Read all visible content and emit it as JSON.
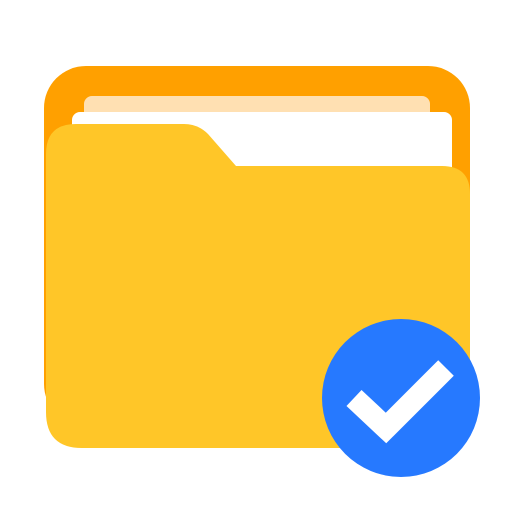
{
  "icon": {
    "name": "folder-verified-icon",
    "description_parts": [
      "folder-back",
      "paper-sheet-back",
      "paper-sheet-front",
      "folder-front",
      "check-badge"
    ]
  },
  "colors": {
    "background": "#ffffff",
    "folder_back": "#ffa000",
    "paper_back": "#ffe0b2",
    "paper_front": "#ffffff",
    "folder_front": "#ffc628",
    "badge": "#2679ff",
    "check": "#ffffff"
  }
}
